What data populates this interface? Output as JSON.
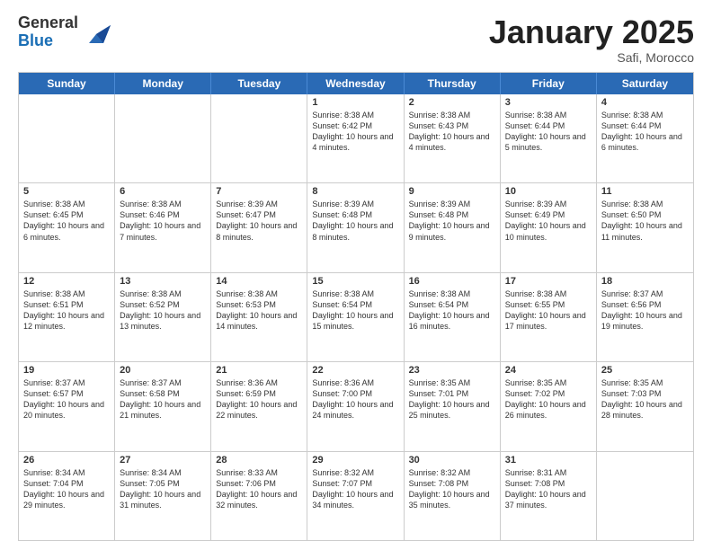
{
  "header": {
    "logo_general": "General",
    "logo_blue": "Blue",
    "month_title": "January 2025",
    "location": "Safi, Morocco"
  },
  "calendar": {
    "days_of_week": [
      "Sunday",
      "Monday",
      "Tuesday",
      "Wednesday",
      "Thursday",
      "Friday",
      "Saturday"
    ],
    "rows": [
      [
        {
          "day": "",
          "info": ""
        },
        {
          "day": "",
          "info": ""
        },
        {
          "day": "",
          "info": ""
        },
        {
          "day": "1",
          "info": "Sunrise: 8:38 AM\nSunset: 6:42 PM\nDaylight: 10 hours\nand 4 minutes."
        },
        {
          "day": "2",
          "info": "Sunrise: 8:38 AM\nSunset: 6:43 PM\nDaylight: 10 hours\nand 4 minutes."
        },
        {
          "day": "3",
          "info": "Sunrise: 8:38 AM\nSunset: 6:44 PM\nDaylight: 10 hours\nand 5 minutes."
        },
        {
          "day": "4",
          "info": "Sunrise: 8:38 AM\nSunset: 6:44 PM\nDaylight: 10 hours\nand 6 minutes."
        }
      ],
      [
        {
          "day": "5",
          "info": "Sunrise: 8:38 AM\nSunset: 6:45 PM\nDaylight: 10 hours\nand 6 minutes."
        },
        {
          "day": "6",
          "info": "Sunrise: 8:38 AM\nSunset: 6:46 PM\nDaylight: 10 hours\nand 7 minutes."
        },
        {
          "day": "7",
          "info": "Sunrise: 8:39 AM\nSunset: 6:47 PM\nDaylight: 10 hours\nand 8 minutes."
        },
        {
          "day": "8",
          "info": "Sunrise: 8:39 AM\nSunset: 6:48 PM\nDaylight: 10 hours\nand 8 minutes."
        },
        {
          "day": "9",
          "info": "Sunrise: 8:39 AM\nSunset: 6:48 PM\nDaylight: 10 hours\nand 9 minutes."
        },
        {
          "day": "10",
          "info": "Sunrise: 8:39 AM\nSunset: 6:49 PM\nDaylight: 10 hours\nand 10 minutes."
        },
        {
          "day": "11",
          "info": "Sunrise: 8:38 AM\nSunset: 6:50 PM\nDaylight: 10 hours\nand 11 minutes."
        }
      ],
      [
        {
          "day": "12",
          "info": "Sunrise: 8:38 AM\nSunset: 6:51 PM\nDaylight: 10 hours\nand 12 minutes."
        },
        {
          "day": "13",
          "info": "Sunrise: 8:38 AM\nSunset: 6:52 PM\nDaylight: 10 hours\nand 13 minutes."
        },
        {
          "day": "14",
          "info": "Sunrise: 8:38 AM\nSunset: 6:53 PM\nDaylight: 10 hours\nand 14 minutes."
        },
        {
          "day": "15",
          "info": "Sunrise: 8:38 AM\nSunset: 6:54 PM\nDaylight: 10 hours\nand 15 minutes."
        },
        {
          "day": "16",
          "info": "Sunrise: 8:38 AM\nSunset: 6:54 PM\nDaylight: 10 hours\nand 16 minutes."
        },
        {
          "day": "17",
          "info": "Sunrise: 8:38 AM\nSunset: 6:55 PM\nDaylight: 10 hours\nand 17 minutes."
        },
        {
          "day": "18",
          "info": "Sunrise: 8:37 AM\nSunset: 6:56 PM\nDaylight: 10 hours\nand 19 minutes."
        }
      ],
      [
        {
          "day": "19",
          "info": "Sunrise: 8:37 AM\nSunset: 6:57 PM\nDaylight: 10 hours\nand 20 minutes."
        },
        {
          "day": "20",
          "info": "Sunrise: 8:37 AM\nSunset: 6:58 PM\nDaylight: 10 hours\nand 21 minutes."
        },
        {
          "day": "21",
          "info": "Sunrise: 8:36 AM\nSunset: 6:59 PM\nDaylight: 10 hours\nand 22 minutes."
        },
        {
          "day": "22",
          "info": "Sunrise: 8:36 AM\nSunset: 7:00 PM\nDaylight: 10 hours\nand 24 minutes."
        },
        {
          "day": "23",
          "info": "Sunrise: 8:35 AM\nSunset: 7:01 PM\nDaylight: 10 hours\nand 25 minutes."
        },
        {
          "day": "24",
          "info": "Sunrise: 8:35 AM\nSunset: 7:02 PM\nDaylight: 10 hours\nand 26 minutes."
        },
        {
          "day": "25",
          "info": "Sunrise: 8:35 AM\nSunset: 7:03 PM\nDaylight: 10 hours\nand 28 minutes."
        }
      ],
      [
        {
          "day": "26",
          "info": "Sunrise: 8:34 AM\nSunset: 7:04 PM\nDaylight: 10 hours\nand 29 minutes."
        },
        {
          "day": "27",
          "info": "Sunrise: 8:34 AM\nSunset: 7:05 PM\nDaylight: 10 hours\nand 31 minutes."
        },
        {
          "day": "28",
          "info": "Sunrise: 8:33 AM\nSunset: 7:06 PM\nDaylight: 10 hours\nand 32 minutes."
        },
        {
          "day": "29",
          "info": "Sunrise: 8:32 AM\nSunset: 7:07 PM\nDaylight: 10 hours\nand 34 minutes."
        },
        {
          "day": "30",
          "info": "Sunrise: 8:32 AM\nSunset: 7:08 PM\nDaylight: 10 hours\nand 35 minutes."
        },
        {
          "day": "31",
          "info": "Sunrise: 8:31 AM\nSunset: 7:08 PM\nDaylight: 10 hours\nand 37 minutes."
        },
        {
          "day": "",
          "info": ""
        }
      ]
    ]
  }
}
